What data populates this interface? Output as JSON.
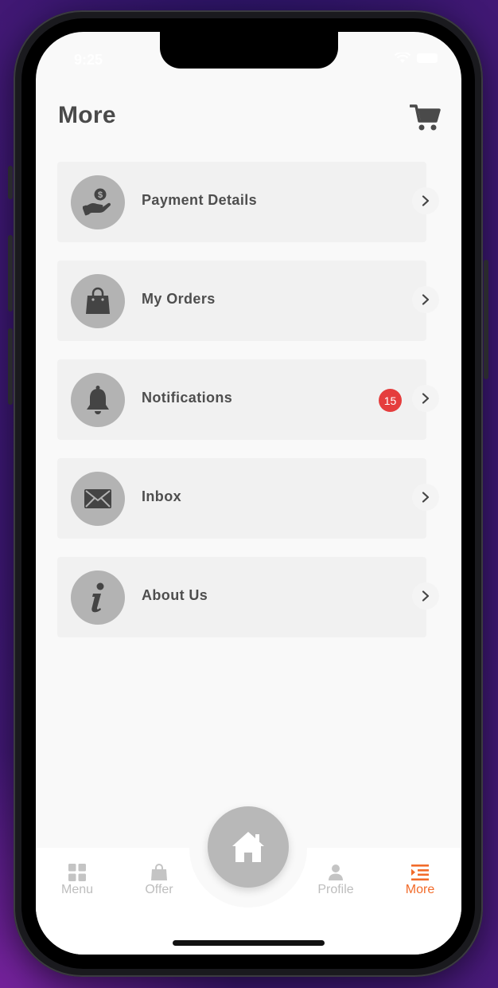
{
  "status_bar": {
    "time": "9:25"
  },
  "header": {
    "title": "More",
    "cart_icon": "cart-icon"
  },
  "menu": {
    "items": [
      {
        "label": "Payment Details",
        "icon": "payment-hand-icon"
      },
      {
        "label": "My Orders",
        "icon": "shopping-bag-icon"
      },
      {
        "label": "Notifications",
        "icon": "bell-icon",
        "badge": "15"
      },
      {
        "label": "Inbox",
        "icon": "envelope-icon"
      },
      {
        "label": "About Us",
        "icon": "info-icon"
      }
    ]
  },
  "bottom_nav": {
    "items": [
      {
        "label": "Menu",
        "icon": "grid-icon"
      },
      {
        "label": "Offer",
        "icon": "bag-icon"
      },
      {
        "label": "Profile",
        "icon": "person-icon"
      },
      {
        "label": "More",
        "icon": "list-icon",
        "active": true
      }
    ],
    "home_icon": "home-icon"
  },
  "colors": {
    "accent": "#f26b2a",
    "badge": "#e53d3d",
    "icon_circle": "#b3b3b3",
    "card_bg": "#f1f1f1",
    "text": "#4e4e4e"
  }
}
